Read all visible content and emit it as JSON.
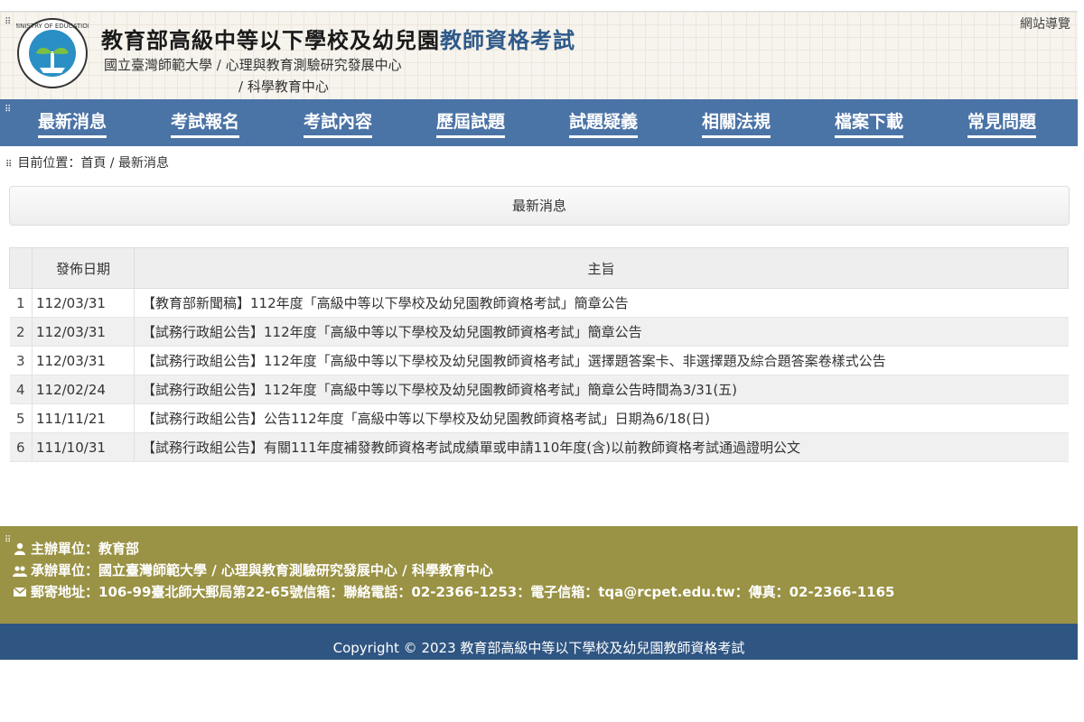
{
  "header": {
    "title_main": "教育部高級中等以下學校及幼兒園",
    "title_accent": "教師資格考試",
    "subtitle_line1": "國立臺灣師範大學 / 心理與教育測驗研究發展中心",
    "subtitle_line2": "/ 科學教育中心",
    "sitemap": "網站導覽",
    "logo_icon": "ministry-of-education-logo"
  },
  "nav": {
    "items": [
      "最新消息",
      "考試報名",
      "考試內容",
      "歷屆試題",
      "試題疑義",
      "相關法規",
      "檔案下載",
      "常見問題"
    ]
  },
  "breadcrumb": "目前位置：首頁 / 最新消息",
  "panel": {
    "title": "最新消息"
  },
  "table": {
    "headers": [
      "",
      "發佈日期",
      "主旨"
    ],
    "rows": [
      {
        "no": "1",
        "date": "112/03/31",
        "subject": "【教育部新聞稿】112年度「高級中等以下學校及幼兒園教師資格考試」簡章公告"
      },
      {
        "no": "2",
        "date": "112/03/31",
        "subject": "【試務行政組公告】112年度「高級中等以下學校及幼兒園教師資格考試」簡章公告"
      },
      {
        "no": "3",
        "date": "112/03/31",
        "subject": "【試務行政組公告】112年度「高級中等以下學校及幼兒園教師資格考試」選擇題答案卡、非選擇題及綜合題答案卷樣式公告"
      },
      {
        "no": "4",
        "date": "112/02/24",
        "subject": "【試務行政組公告】112年度「高級中等以下學校及幼兒園教師資格考試」簡章公告時間為3/31(五)"
      },
      {
        "no": "5",
        "date": "111/11/21",
        "subject": "【試務行政組公告】公告112年度「高級中等以下學校及幼兒園教師資格考試」日期為6/18(日)"
      },
      {
        "no": "6",
        "date": "111/10/31",
        "subject": "【試務行政組公告】有關111年度補發教師資格考試成績單或申請110年度(含)以前教師資格考試通過證明公文"
      }
    ]
  },
  "footer": {
    "organizer": "主辦單位：教育部",
    "contractor": "承辦單位：國立臺灣師範大學 / 心理與教育測驗研究發展中心 / 科學教育中心",
    "address": "郵寄地址：106-99臺北師大郵局第22-65號信箱：聯絡電話：02-2366-1253：電子信箱：tqa@rcpet.edu.tw：傳真：02-2366-1165",
    "copyright": "Copyright © 2023 教育部高級中等以下學校及幼兒園教師資格考試"
  },
  "colors": {
    "nav": "#4a73a6",
    "footer": "#9a9244",
    "copyright_bar": "#2f5582",
    "accent": "#2e5a8a"
  }
}
